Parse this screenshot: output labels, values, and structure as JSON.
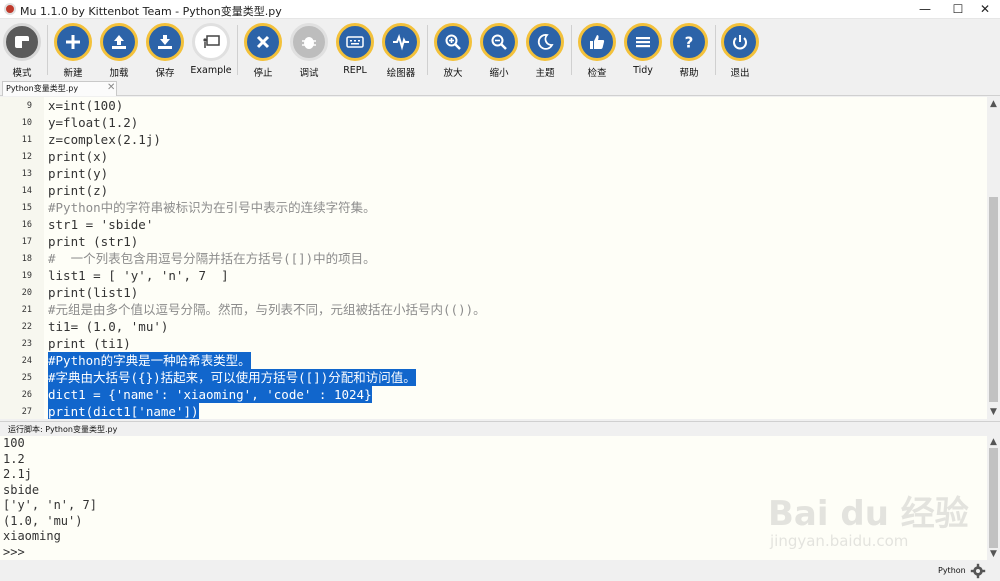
{
  "window": {
    "title": "Mu 1.1.0 by Kittenbot Team - Python变量类型.py",
    "controls": {
      "minimize": "—",
      "maximize": "☐",
      "close": "✕"
    }
  },
  "toolbar": {
    "buttons": [
      {
        "label": "模式",
        "icon": "mode-icon"
      },
      {
        "label": "新建",
        "icon": "plus-icon"
      },
      {
        "label": "加载",
        "icon": "upload-icon"
      },
      {
        "label": "保存",
        "icon": "download-icon"
      },
      {
        "label": "Example",
        "icon": "presentation-icon"
      },
      {
        "label": "停止",
        "icon": "close-icon"
      },
      {
        "label": "调试",
        "icon": "bug-icon"
      },
      {
        "label": "REPL",
        "icon": "keyboard-icon"
      },
      {
        "label": "绘图器",
        "icon": "pulse-icon"
      },
      {
        "label": "放大",
        "icon": "zoom-in-icon"
      },
      {
        "label": "缩小",
        "icon": "zoom-out-icon"
      },
      {
        "label": "主题",
        "icon": "moon-icon"
      },
      {
        "label": "检查",
        "icon": "thumbs-up-icon"
      },
      {
        "label": "Tidy",
        "icon": "menu-lines-icon"
      },
      {
        "label": "帮助",
        "icon": "question-icon"
      },
      {
        "label": "退出",
        "icon": "power-icon"
      }
    ]
  },
  "tab": {
    "label": "Python变量类型.py",
    "close": "✕"
  },
  "editor": {
    "lines": [
      {
        "num": "9",
        "text": "x=int(100)"
      },
      {
        "num": "10",
        "text": "y=float(1.2)"
      },
      {
        "num": "11",
        "text": "z=complex(2.1j)"
      },
      {
        "num": "12",
        "text": "print(x)"
      },
      {
        "num": "13",
        "text": "print(y)"
      },
      {
        "num": "14",
        "text": "print(z)"
      },
      {
        "num": "15",
        "text": "#Python中的字符串被标识为在引号中表示的连续字符集。"
      },
      {
        "num": "16",
        "text": "str1 = 'sbide'"
      },
      {
        "num": "17",
        "text": "print (str1)"
      },
      {
        "num": "18",
        "text": "#  一个列表包含用逗号分隔并括在方括号([])中的项目。"
      },
      {
        "num": "19",
        "text": "list1 = [ 'y', 'n', 7  ]"
      },
      {
        "num": "20",
        "text": "print(list1)"
      },
      {
        "num": "21",
        "text": "#元组是由多个值以逗号分隔。然而，与列表不同，元组被括在小括号内(())。"
      },
      {
        "num": "22",
        "text": "ti1= (1.0, 'mu')"
      },
      {
        "num": "23",
        "text": "print (ti1)"
      },
      {
        "num": "24",
        "text": "#Python的字典是一种哈希表类型。"
      },
      {
        "num": "25",
        "text": "#字典由大括号({})括起来，可以使用方括号([])分配和访问值。"
      },
      {
        "num": "26",
        "text": "dict1 = {'name': 'xiaoming', 'code' : 1024}"
      },
      {
        "num": "27",
        "text": "print(dict1['name'])"
      }
    ]
  },
  "repl": {
    "header": "运行脚本: Python变量类型.py",
    "output": [
      "100",
      "1.2",
      "2.1j",
      "sbide",
      "['y', 'n', 7]",
      "(1.0, 'mu')",
      "xiaoming",
      ">>>"
    ]
  },
  "watermark": {
    "logo": "Bai du 经验",
    "url": "jingyan.baidu.com"
  },
  "status": {
    "mode": "Python"
  },
  "colors": {
    "accent_ring": "#f3c13a",
    "button_fill": "#2c63a8",
    "selection": "#1166cc",
    "editor_bg": "#fefef7"
  }
}
